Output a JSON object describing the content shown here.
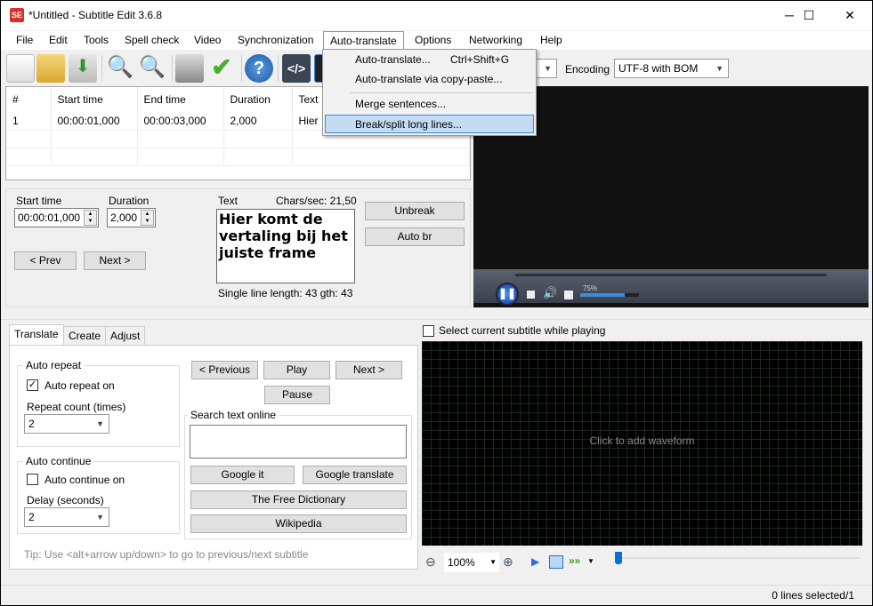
{
  "window": {
    "title": "*Untitled - Subtitle Edit 3.6.8",
    "logo": "SE",
    "minimize": "─",
    "maximize": "☐",
    "close": "✕"
  },
  "menubar": [
    "File",
    "Edit",
    "Tools",
    "Spell check",
    "Video",
    "Synchronization",
    "Auto-translate",
    "Options",
    "Networking",
    "Help"
  ],
  "toolbar": {
    "icons": [
      "new-file-icon",
      "open-folder-icon",
      "save-download-icon",
      "find-icon",
      "replace-icon",
      "visual-sync-icon",
      "spell-check-icon",
      "help-icon",
      "source-view-icon",
      "waveform-icon"
    ],
    "encoding_label": "Encoding",
    "encoding_value": "UTF-8 with BOM"
  },
  "auto_translate_menu": [
    {
      "label": "Auto-translate...",
      "shortcut": "Ctrl+Shift+G"
    },
    {
      "label": "Auto-translate via copy-paste...",
      "shortcut": ""
    },
    {
      "label": "Merge sentences...",
      "shortcut": ""
    },
    {
      "label": "Break/split long lines...",
      "shortcut": "",
      "highlighted": true
    }
  ],
  "subtitle_list": {
    "columns": [
      "#",
      "Start time",
      "End time",
      "Duration",
      "Text"
    ],
    "rows": [
      [
        "1",
        "00:00:01,000",
        "00:00:03,000",
        "2,000",
        "Hier"
      ]
    ]
  },
  "edit": {
    "start_time_label": "Start time",
    "start_time": "00:00:01,000",
    "duration_label": "Duration",
    "duration": "2,000",
    "text_label": "Text",
    "chars_sec": "Chars/sec: 21,50",
    "text": "Hier komt de vertaling bij het juiste frame",
    "line_length": "Single line length: 43 gth: 43",
    "unbreak": "Unbreak",
    "auto_br": "Auto br",
    "prev": "< Prev",
    "next": "Next >"
  },
  "video": {
    "volume": "75%",
    "volume_fraction": 0.75
  },
  "tabs": [
    "Translate",
    "Create",
    "Adjust"
  ],
  "translate": {
    "auto_repeat": "Auto repeat",
    "auto_repeat_on": "Auto repeat on",
    "auto_repeat_checked": true,
    "repeat_count_label": "Repeat count (times)",
    "repeat_count": "2",
    "auto_continue": "Auto continue",
    "auto_continue_on": "Auto continue on",
    "auto_continue_checked": false,
    "delay_label": "Delay (seconds)",
    "delay": "2",
    "previous": "< Previous",
    "play": "Play",
    "next": "Next >",
    "pause": "Pause",
    "search_online": "Search text online",
    "search_value": "",
    "google_it": "Google it",
    "google_translate": "Google translate",
    "free_dictionary": "The Free Dictionary",
    "wikipedia": "Wikipedia",
    "tip": "Tip: Use <alt+arrow up/down> to go to previous/next subtitle"
  },
  "waveform": {
    "select_current": "Select current subtitle while playing",
    "checked": false,
    "placeholder": "Click to add waveform",
    "zoom": "100%"
  },
  "status": "0 lines selected/1"
}
